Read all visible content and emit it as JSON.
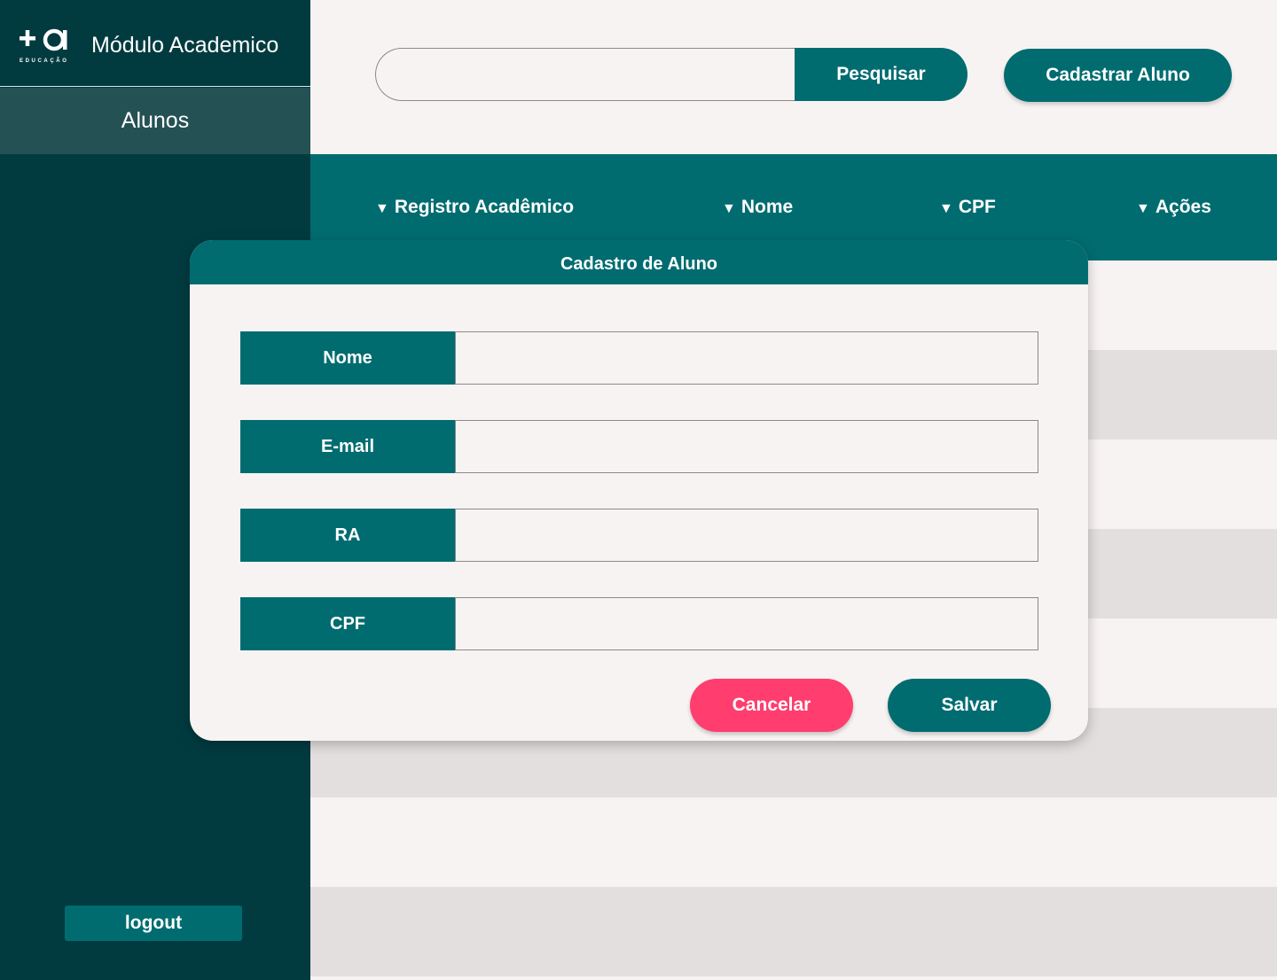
{
  "sidebar": {
    "logo_text": "+a",
    "logo_subtext": "EDUCAÇÃO",
    "app_title": "Módulo Academico",
    "nav": [
      {
        "label": "Alunos",
        "active": true
      }
    ],
    "logout_label": "logout"
  },
  "topbar": {
    "search": {
      "value": "",
      "placeholder": "",
      "button_label": "Pesquisar"
    },
    "add_student_label": "Cadastrar Aluno"
  },
  "table": {
    "columns": [
      {
        "label": "Registro Acadêmico",
        "sort_icon": "triangle-down-icon"
      },
      {
        "label": "Nome",
        "sort_icon": "triangle-down-icon"
      },
      {
        "label": "CPF",
        "sort_icon": "triangle-down-icon"
      },
      {
        "label": "Ações",
        "sort_icon": "triangle-down-icon"
      }
    ],
    "rows": [
      [],
      [],
      [],
      [],
      [],
      [],
      [],
      []
    ]
  },
  "modal": {
    "title": "Cadastro de Aluno",
    "fields": [
      {
        "label": "Nome",
        "value": ""
      },
      {
        "label": "E-mail",
        "value": ""
      },
      {
        "label": "RA",
        "value": ""
      },
      {
        "label": "CPF",
        "value": ""
      }
    ],
    "cancel_label": "Cancelar",
    "save_label": "Salvar"
  },
  "colors": {
    "primary": "#016c70",
    "sidebar_bg": "#013b40",
    "nav_active": "#245154",
    "danger": "#ff3d6e",
    "background": "#f8f3f3",
    "row_alt": "#e3dfdf"
  }
}
